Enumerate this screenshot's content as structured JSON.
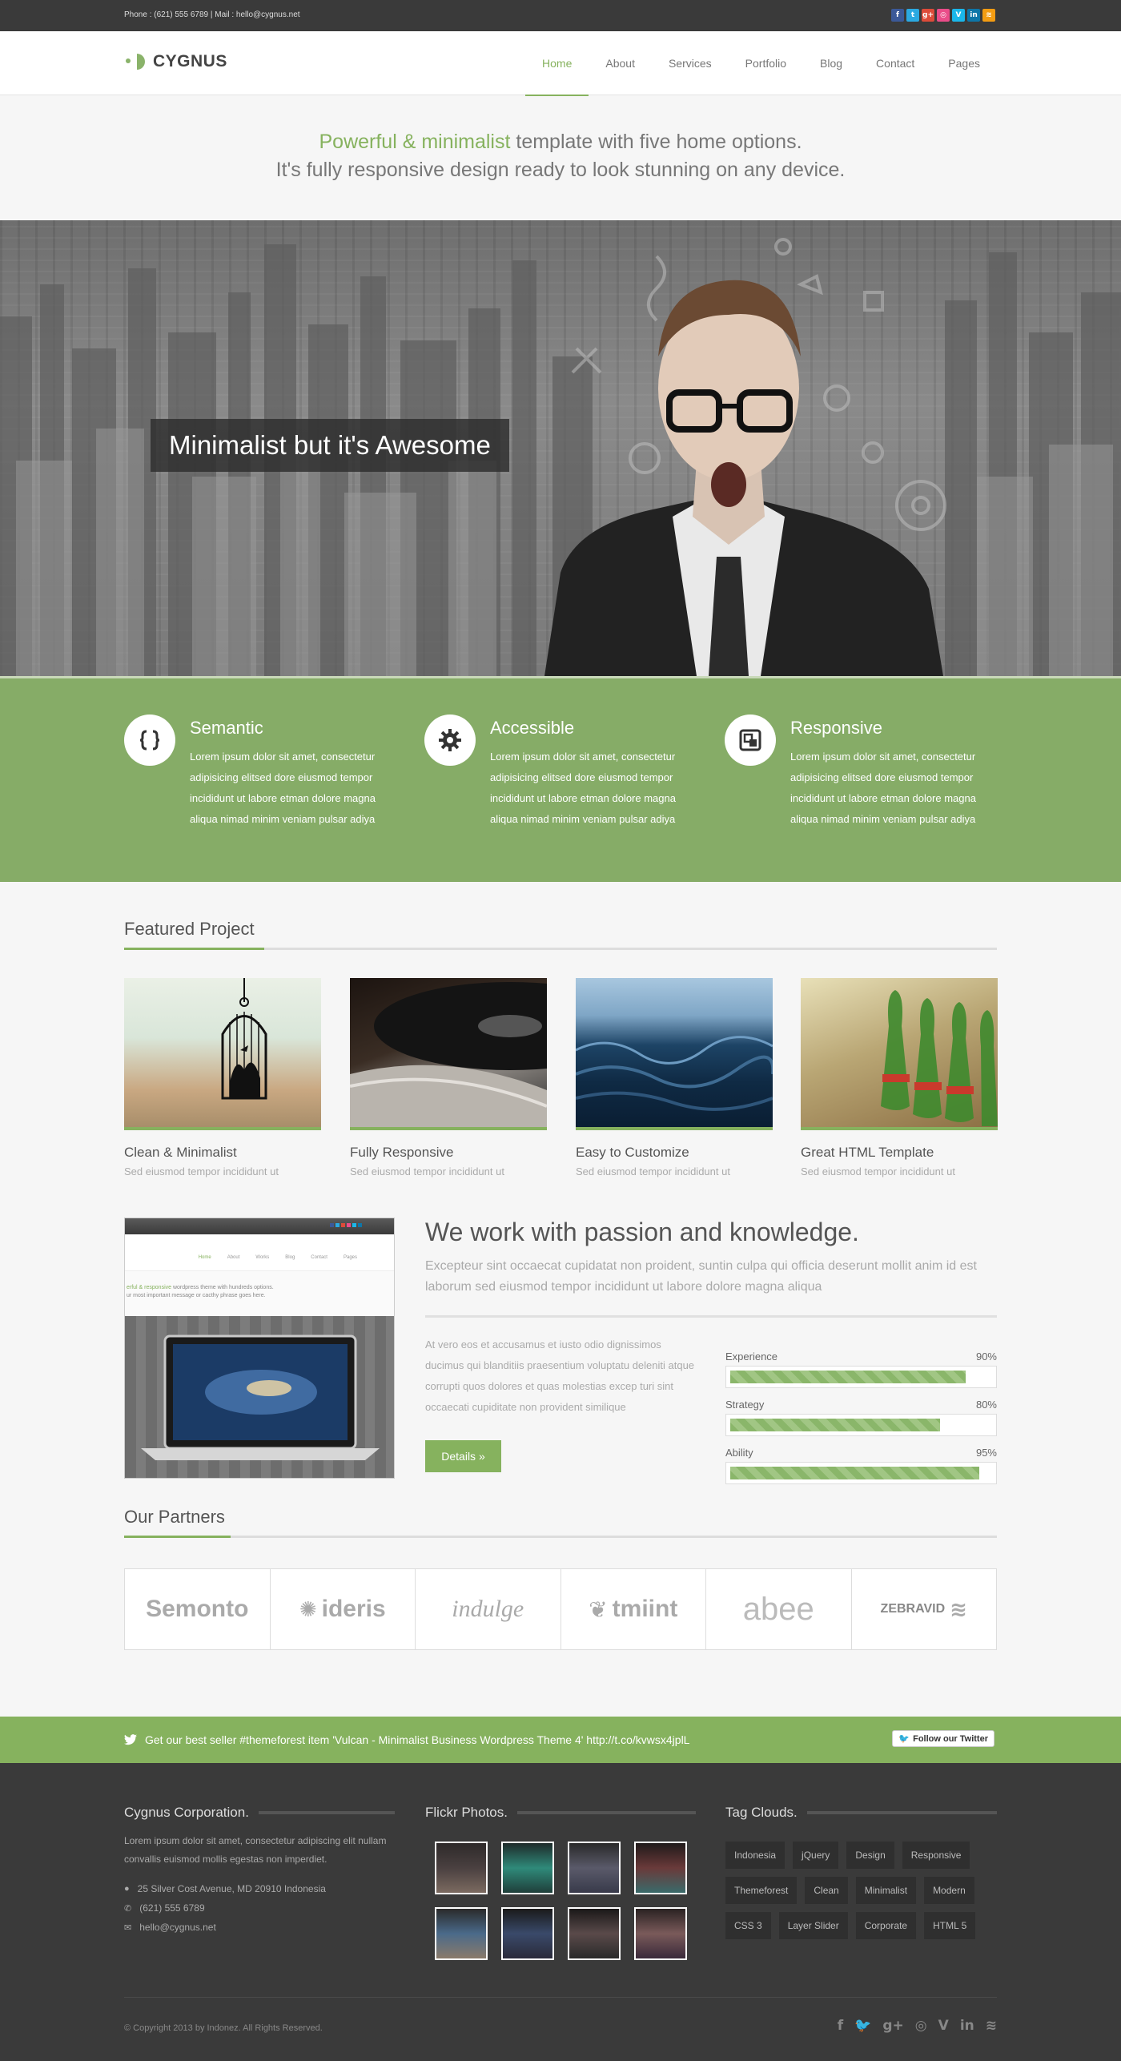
{
  "topbar": {
    "contact": "Phone : (621) 555 6789  |  Mail : hello@cygnus.net",
    "social": [
      {
        "icon": "facebook-icon",
        "glyph": "f",
        "color": "#3b5998"
      },
      {
        "icon": "twitter-icon",
        "glyph": "t",
        "color": "#2ba9e1"
      },
      {
        "icon": "google-plus-icon",
        "glyph": "g+",
        "color": "#dd4b39"
      },
      {
        "icon": "dribbble-icon",
        "glyph": "◎",
        "color": "#ea4c89"
      },
      {
        "icon": "vimeo-icon",
        "glyph": "V",
        "color": "#1ab7ea"
      },
      {
        "icon": "linkedin-icon",
        "glyph": "in",
        "color": "#0e76a8"
      },
      {
        "icon": "rss-icon",
        "glyph": "≋",
        "color": "#f39c12"
      }
    ]
  },
  "header": {
    "logo": "CYGNUS",
    "nav": [
      "Home",
      "About",
      "Services",
      "Portfolio",
      "Blog",
      "Contact",
      "Pages"
    ],
    "active_nav": "Home"
  },
  "intro": {
    "highlight": "Powerful & minimalist",
    "line1_rest": " template with five home options.",
    "line2": "It's fully responsive design ready to look stunning on any device."
  },
  "hero": {
    "caption": "Minimalist but it's Awesome"
  },
  "features": [
    {
      "icon": "code-braces-icon",
      "title": "Semantic",
      "text": "Lorem ipsum dolor sit amet, consectetur adipisicing elitsed dore eiusmod tempor incididunt ut labore etman dolore magna aliqua nimad minim veniam pulsar adiya"
    },
    {
      "icon": "gear-icon",
      "title": "Accessible",
      "text": "Lorem ipsum dolor sit amet, consectetur adipisicing elitsed dore eiusmod tempor incididunt ut labore etman dolore magna aliqua nimad minim veniam pulsar adiya"
    },
    {
      "icon": "responsive-icon",
      "title": "Responsive",
      "text": "Lorem ipsum dolor sit amet, consectetur adipisicing elitsed dore eiusmod tempor incididunt ut labore etman dolore magna aliqua nimad minim veniam pulsar adiya"
    }
  ],
  "featured": {
    "title": "Featured Project",
    "projects": [
      {
        "title": "Clean & Minimalist",
        "sub": "Sed eiusmod tempor incididunt ut"
      },
      {
        "title": "Fully Responsive",
        "sub": "Sed eiusmod tempor incididunt ut"
      },
      {
        "title": "Easy to Customize",
        "sub": "Sed eiusmod tempor incididunt ut"
      },
      {
        "title": "Great HTML Template",
        "sub": "Sed eiusmod tempor incididunt ut"
      }
    ]
  },
  "work": {
    "title": "We work with passion and knowledge.",
    "sub": "Excepteur sint occaecat cupidatat non proident, suntin culpa qui officia deserunt mollit anim id est laborum sed eiusmod tempor incididunt ut labore dolore magna aliqua",
    "text": "At vero eos et accusamus et iusto odio dignissimos ducimus qui blanditiis praesentium voluptatu deleniti atque corrupti quos dolores et quas molestias excep turi sint occaecati cupiditate non provident similique",
    "button": "Details »",
    "screenshot": {
      "nav": [
        "Home",
        "About",
        "Works",
        "Blog",
        "Contact",
        "Pages"
      ],
      "line1_green": "erful & responsive",
      "line1_rest": " wordpress theme with hundreds options.",
      "line2": "ur most important message or cacthy phrase goes here."
    },
    "skills": [
      {
        "name": "Experience",
        "label": "90%",
        "value": 0.9
      },
      {
        "name": "Strategy",
        "label": "80%",
        "value": 0.8
      },
      {
        "name": "Ability",
        "label": "95%",
        "value": 0.95
      }
    ]
  },
  "partners": {
    "title": "Our Partners",
    "logos": [
      "Semonto",
      "ideris",
      "indulge",
      "tmiint",
      "abee",
      "ZEBRAVID"
    ]
  },
  "twitter": {
    "message": "Get our best seller #themeforest item 'Vulcan - Minimalist Business Wordpress Theme 4' http://t.co/kvwsx4jplL",
    "follow": "Follow our Twitter"
  },
  "footer": {
    "about_title": "Cygnus Corporation.",
    "about_text": "Lorem ipsum dolor sit amet, consectetur adipiscing elit nullam convallis euismod mollis egestas non imperdiet.",
    "address": "25 Silver Cost Avenue, MD 20910 Indonesia",
    "phone": "(621) 555 6789",
    "email": "hello@cygnus.net",
    "flickr_title": "Flickr Photos.",
    "tags_title": "Tag Clouds.",
    "tags": [
      "Indonesia",
      "jQuery",
      "Design",
      "Responsive",
      "Themeforest",
      "Clean",
      "Minimalist",
      "Modern",
      "CSS 3",
      "Layer Slider",
      "Corporate",
      "HTML 5"
    ],
    "copyright": "© Copyright 2013 by Indonez. All Rights Reserved.",
    "social": [
      {
        "icon": "facebook-icon",
        "glyph": "f"
      },
      {
        "icon": "twitter-icon",
        "glyph": "🐦"
      },
      {
        "icon": "google-plus-icon",
        "glyph": "g+"
      },
      {
        "icon": "dribbble-icon",
        "glyph": "◎"
      },
      {
        "icon": "vimeo-icon",
        "glyph": "V"
      },
      {
        "icon": "linkedin-icon",
        "glyph": "in"
      },
      {
        "icon": "rss-icon",
        "glyph": "≋"
      }
    ]
  },
  "colors": {
    "accent": "#86b25e",
    "dark": "#3a3a3a"
  }
}
